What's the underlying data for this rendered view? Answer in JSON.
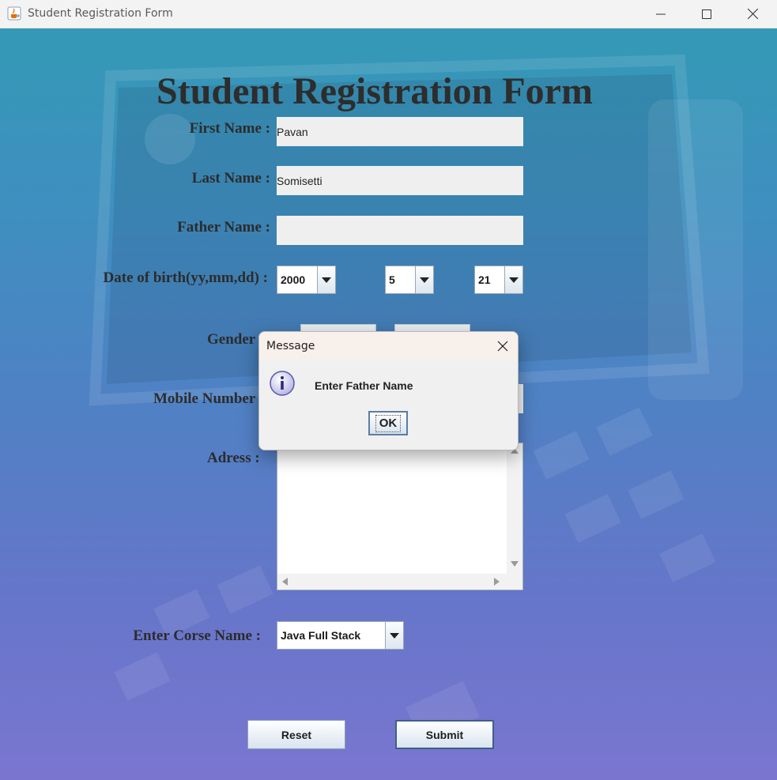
{
  "window": {
    "title": "Student Registration Form",
    "app_icon": "java-cup-icon"
  },
  "form": {
    "heading": "Student Registration Form",
    "first_name": {
      "label": "First Name :",
      "value": "Pavan"
    },
    "last_name": {
      "label": "Last Name :",
      "value": "Somisetti"
    },
    "father_name": {
      "label": "Father Name :",
      "value": ""
    },
    "dob": {
      "label": "Date of birth(yy,mm,dd) :",
      "year": "2000",
      "month": "5",
      "day": "21"
    },
    "gender": {
      "label": "Gender"
    },
    "mobile": {
      "label": "Mobile Number"
    },
    "address": {
      "label": "Adress :"
    },
    "course": {
      "label": "Enter Corse Name :",
      "value": "Java Full Stack"
    },
    "reset_label": "Reset",
    "submit_label": "Submit"
  },
  "dialog": {
    "title": "Message",
    "message": "Enter Father Name",
    "ok_label": "OK",
    "icon": "info-icon"
  },
  "colors": {
    "bg_top": "#3499b6",
    "bg_bottom": "#7a76d0",
    "heading": "#2d2d2d"
  }
}
